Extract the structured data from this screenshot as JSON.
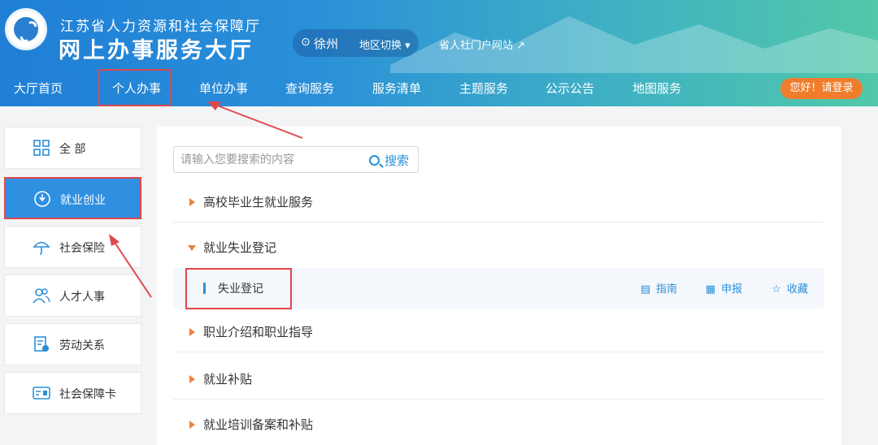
{
  "header": {
    "org_name": "江苏省人力资源和社会保障厅",
    "hall_name": "网上办事服务大厅",
    "location": "徐州",
    "region_switch": "地区切换",
    "portal_link": "省人社门户网站",
    "login": "您好！请登录"
  },
  "nav": {
    "items": [
      {
        "label": "大厅首页"
      },
      {
        "label": "个人办事"
      },
      {
        "label": "单位办事"
      },
      {
        "label": "查询服务"
      },
      {
        "label": "服务清单"
      },
      {
        "label": "主题服务"
      },
      {
        "label": "公示公告"
      },
      {
        "label": "地图服务"
      }
    ],
    "active": "个人办事"
  },
  "sidebar": {
    "items": [
      {
        "label": "全 部",
        "icon": "grid-icon"
      },
      {
        "label": "就业创业",
        "icon": "employment-icon"
      },
      {
        "label": "社会保险",
        "icon": "umbrella-icon"
      },
      {
        "label": "人才人事",
        "icon": "people-icon"
      },
      {
        "label": "劳动关系",
        "icon": "document-icon"
      },
      {
        "label": "社会保障卡",
        "icon": "card-icon"
      }
    ],
    "active": "就业创业"
  },
  "search": {
    "placeholder": "请输入您要搜索的内容",
    "value": "",
    "button": "搜索"
  },
  "categories": [
    {
      "name": "高校毕业生就业服务",
      "expanded": false
    },
    {
      "name": "就业失业登记",
      "expanded": true
    },
    {
      "name": "职业介绍和职业指导",
      "expanded": false
    },
    {
      "name": "就业补贴",
      "expanded": false
    },
    {
      "name": "就业培训备案和补贴",
      "expanded": false
    }
  ],
  "sub_item": {
    "name": "失业登记",
    "actions": [
      {
        "label": "指南",
        "icon": "guide-icon"
      },
      {
        "label": "申报",
        "icon": "apply-icon"
      },
      {
        "label": "收藏",
        "icon": "star-icon"
      }
    ]
  },
  "colors": {
    "primary": "#2a8fd8",
    "highlight_red": "#e0484c",
    "login_orange": "#f07d2c",
    "triangle_orange": "#e8843c"
  }
}
